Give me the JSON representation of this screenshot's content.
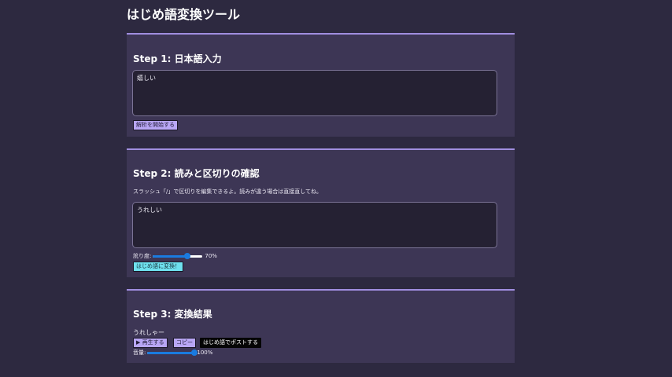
{
  "app": {
    "title": "はじめ語変換ツール"
  },
  "step1": {
    "title": "Step 1: 日本語入力",
    "input_value": "嬉しい",
    "analyze_button": "解析を開始する"
  },
  "step2": {
    "title": "Step 2: 読みと区切りの確認",
    "description": "スラッシュ「/」で区切りを編集できるよ。読みが違う場合は直接直してね。",
    "reading_value": "うれしい",
    "slider_label": "訛り度:",
    "slider_value": "70%",
    "slider_fraction": 0.7,
    "convert_button": "はじめ語に変換！"
  },
  "step3": {
    "title": "Step 3: 変換結果",
    "result_text": "うれしゃー",
    "play_button": "▶ 再生する",
    "copy_button": "コピー",
    "post_button": "はじめ語でポストする",
    "volume_label": "音量:",
    "volume_value": "100%",
    "volume_fraction": 1.0
  },
  "colors": {
    "background": "#2d2940",
    "card": "#3d3655",
    "card_accent": "#a08ee0",
    "button_purple": "#b8a6f5",
    "button_cyan": "#6fe1ef",
    "slider_fill": "#1a7be0"
  }
}
